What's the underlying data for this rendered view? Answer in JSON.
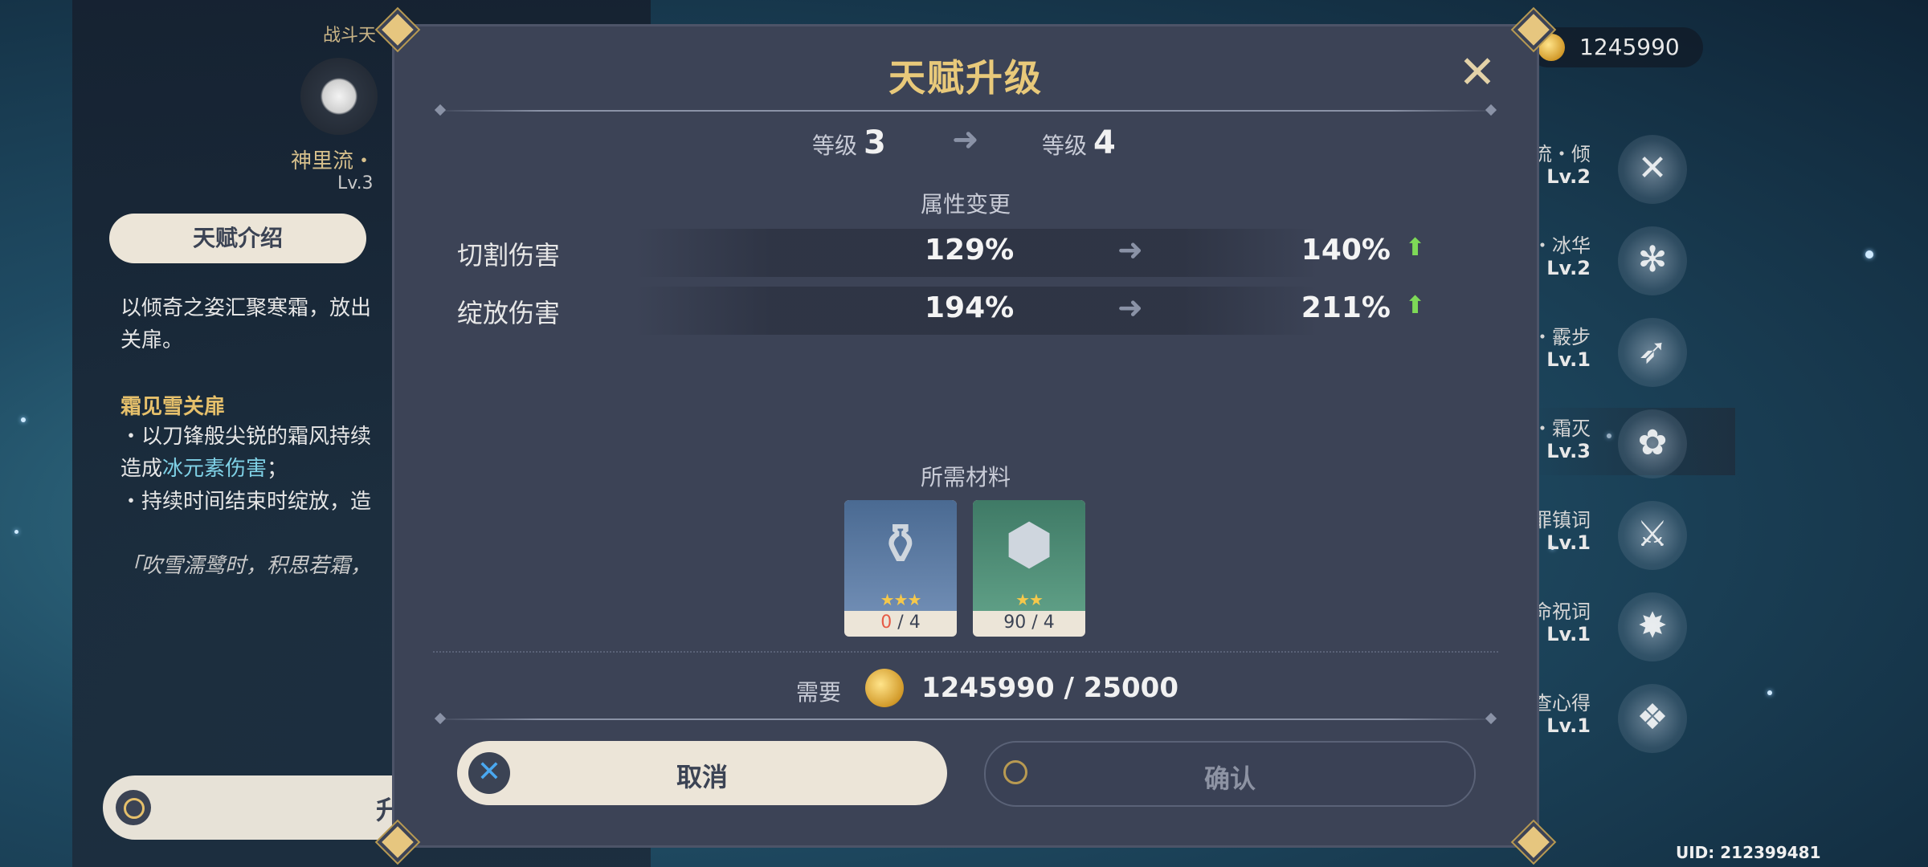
{
  "background_left": {
    "category": "战斗天",
    "name": "神里流・",
    "level": "Lv.3",
    "tab_label": "天赋介绍",
    "desc_line1": "以倾奇之姿汇聚寒霜，放出",
    "desc_line2": "关扉。",
    "subheading": "霜见雪关扉",
    "bullet1_a": "・以刀锋般尖锐的霜风持续",
    "bullet1_b": "造成",
    "bullet1_hl": "冰元素伤害",
    "bullet1_c": "；",
    "bullet2": "・持续时间结束时绽放，造",
    "quote": "「吹雪濡鹭时，积思若霜，",
    "upgrade_label": "升级"
  },
  "currency": {
    "mora": "1245990",
    "coin_icon": "mora-coin-icon"
  },
  "talents": [
    {
      "name": "神里流・倾",
      "level": "Lv.2",
      "icon": "sword-icon",
      "active": false
    },
    {
      "name": "神里流・冰华",
      "level": "Lv.2",
      "icon": "snowflake-icon",
      "active": false
    },
    {
      "name": "神里流・霰步",
      "level": "Lv.1",
      "icon": "dash-icon",
      "active": false
    },
    {
      "name": "神里流・霜灭",
      "level": "Lv.3",
      "icon": "flower-icon",
      "active": true
    },
    {
      "name": "天罪国罪镇词",
      "level": "Lv.1",
      "icon": "blade-icon",
      "active": false
    },
    {
      "name": "宿命祝词",
      "level": "Lv.1",
      "icon": "sun-icon",
      "active": false
    },
    {
      "name": "鉴查心得",
      "level": "Lv.1",
      "icon": "cards-icon",
      "active": false
    }
  ],
  "uid": "UID: 212399481",
  "dialog": {
    "title": "天赋升级",
    "level_label": "等级",
    "level_from": "3",
    "level_to": "4",
    "attr_header": "属性变更",
    "attributes": [
      {
        "name": "切割伤害",
        "old": "129%",
        "new": "140%"
      },
      {
        "name": "绽放伤害",
        "old": "194%",
        "new": "211%"
      }
    ],
    "materials_header": "所需材料",
    "materials": [
      {
        "icon": "kettle-icon",
        "stars": "★★★",
        "have": "0",
        "need": " / 4",
        "short": true,
        "color": "blue"
      },
      {
        "icon": "crystal-icon",
        "stars": "★★",
        "have": "90",
        "need": " / 4",
        "short": false,
        "color": "green"
      }
    ],
    "require_label": "需要",
    "require_value": "1245990 / 25000",
    "cancel_label": "取消",
    "confirm_label": "确认"
  },
  "colors": {
    "title_gold": "#e8c97a",
    "up_green": "#7ed957",
    "short_red": "#e65a46",
    "cancel_blue": "#4aa8f0",
    "dialog_bg": "#3c4356"
  }
}
